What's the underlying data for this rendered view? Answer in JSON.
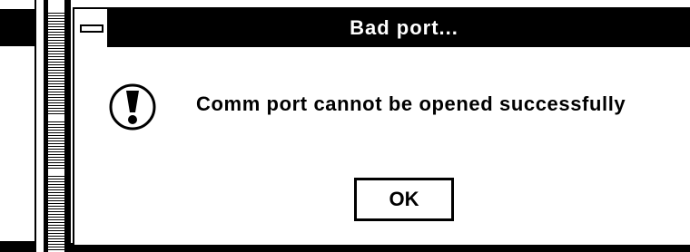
{
  "dialog": {
    "title": "Bad port...",
    "message": "Comm port cannot be opened successfully",
    "ok_label": "OK",
    "icon": "exclamation-icon"
  },
  "colors": {
    "titlebar": "#000000",
    "background": "#ffffff",
    "border": "#000000"
  }
}
